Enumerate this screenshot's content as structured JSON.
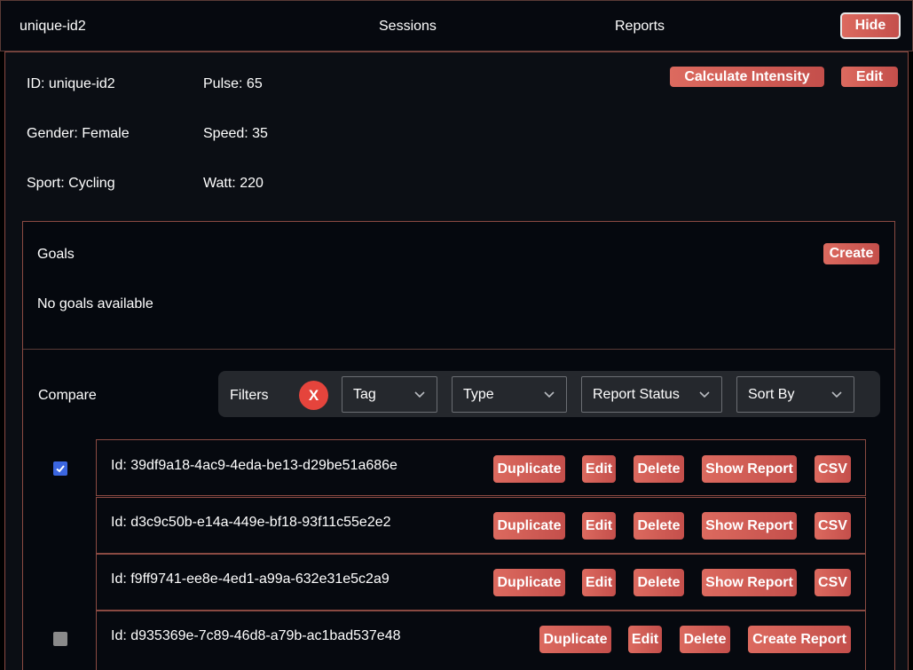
{
  "header": {
    "title": "unique-id2",
    "nav": [
      "Sessions",
      "Reports"
    ],
    "hide_label": "Hide"
  },
  "athlete": {
    "id": "ID: unique-id2",
    "gender": "Gender: Female",
    "sport": "Sport: Cycling",
    "pulse": "Pulse: 65",
    "speed": "Speed: 35",
    "watt": "Watt: 220",
    "calculate_label": "Calculate Intensity",
    "edit_label": "Edit"
  },
  "goals": {
    "title": "Goals",
    "create_label": "Create",
    "empty_text": "No goals available"
  },
  "compare": {
    "label": "Compare",
    "filters_label": "Filters",
    "clear_label": "X",
    "selects": [
      "Tag",
      "Type",
      "Report Status",
      "Sort By"
    ]
  },
  "sessions": [
    {
      "id": "Id: 39df9a18-4ac9-4eda-be13-d29be51a686e",
      "checked": true,
      "actions": [
        "Duplicate",
        "Edit",
        "Delete",
        "Show Report",
        "CSV"
      ]
    },
    {
      "id": "Id: d3c9c50b-e14a-449e-bf18-93f11c55e2e2",
      "actions": [
        "Duplicate",
        "Edit",
        "Delete",
        "Show Report",
        "CSV"
      ]
    },
    {
      "id": "Id: f9ff9741-ee8e-4ed1-a99a-632e31e5c2a9",
      "actions": [
        "Duplicate",
        "Edit",
        "Delete",
        "Show Report",
        "CSV"
      ]
    },
    {
      "id": "Id: d935369e-7c89-46d8-a79b-ac1bad537e48",
      "checked": false,
      "actions": [
        "Duplicate",
        "Edit",
        "Delete",
        "Create Report"
      ]
    }
  ],
  "colors": {
    "accent": "#d9605a",
    "checkbox_checked": "#3b66e0",
    "clear_filter": "#e5443c"
  }
}
